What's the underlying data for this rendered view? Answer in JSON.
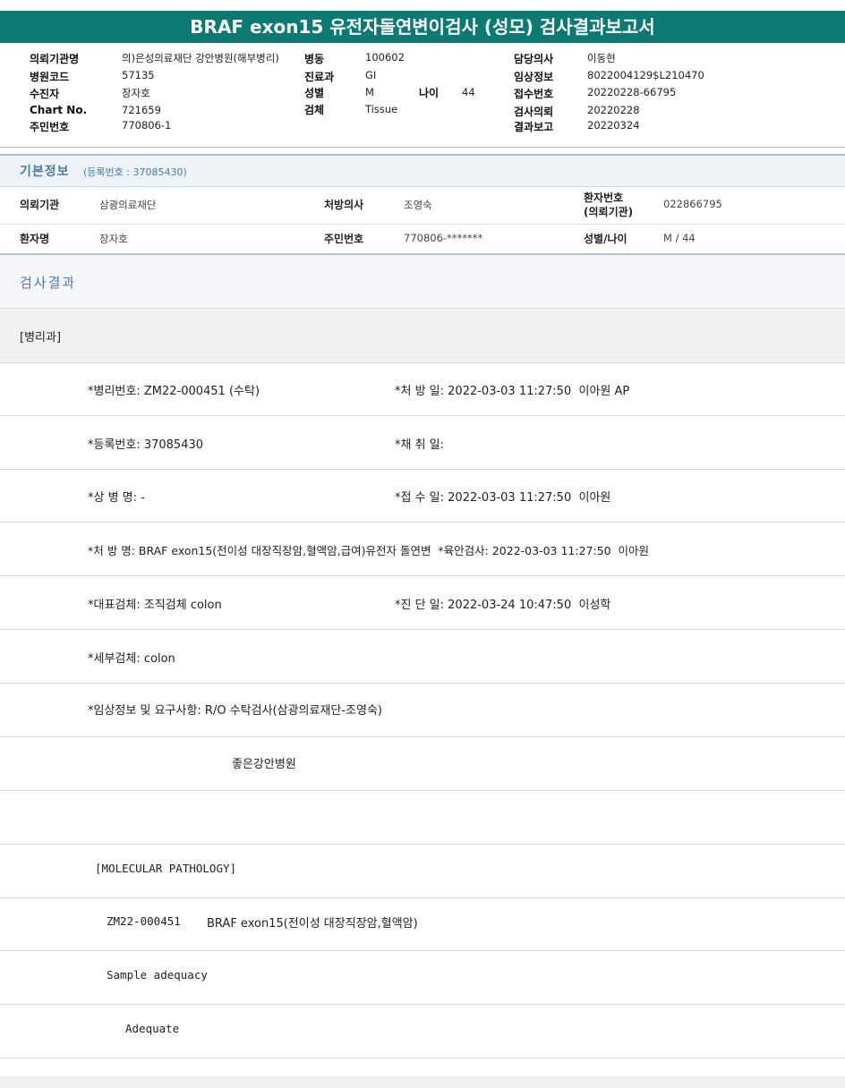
{
  "title": "BRAF exon15 유전자돌연변이검사 (성모) 검사결과보고서",
  "header": {
    "inst_label": "의뢰기관명",
    "inst_value": "의)은성의료재단 강안병원(해부병리)",
    "code_label": "병원코드",
    "code_value": "57135",
    "recv_label": "수진자",
    "recv_value": "장자호",
    "chart_label": "Chart No.",
    "chart_value": "721659",
    "rrn_label": "주민번호",
    "rrn_value": "770806-1",
    "ward_label": "병동",
    "ward_value": "100602",
    "dept_label": "진료과",
    "dept_value": "GI",
    "sex_label": "성별",
    "sex_value": "M",
    "age_label": "나이",
    "age_value": "44",
    "spec_label": "검체",
    "spec_value": "Tissue",
    "doctor_label": "담당의사",
    "doctor_value": "이동현",
    "clinic_label": "임상정보",
    "clinic_value": "8022004129$L210470",
    "receipt_label": "접수번호",
    "receipt_value": "20220228-66795",
    "req_label": "검사의뢰",
    "req_value": "20220228",
    "report_label": "결과보고",
    "report_value": "20220324"
  },
  "basic": {
    "title": "기본정보",
    "sub": "(등록번호 : 37085430)",
    "row1": {
      "inst_label": "의뢰기관",
      "inst_value": "삼광의료재단",
      "doc_label": "처방의사",
      "doc_value": "조영숙",
      "pno_label_1": "환자번호",
      "pno_label_2": "(의뢰기관)",
      "pno_value": "022866795"
    },
    "row2": {
      "name_label": "환자명",
      "name_value": "장자호",
      "rrn_label": "주민번호",
      "rrn_value": "770806-*******",
      "sexage_label": "성별/나이",
      "sexage_value": "M / 44"
    }
  },
  "results": {
    "title": "검사결과",
    "dept": "[병리과]",
    "lines": [
      {
        "left": "*병리번호: ZM22-000451 (수탁)",
        "right": "*처 방 일: 2022-03-03 11:27:50  이아원 AP"
      },
      {
        "left": "*등록번호: 37085430",
        "right": "*채 취 일:"
      },
      {
        "left": "*상 병 명: -",
        "right": "*접 수 일: 2022-03-03 11:27:50  이아원"
      },
      {
        "left": "*처 방 명: BRAF exon15(전이성 대장직장암,혈액암,급여)유전자 돌연변  *육안검사: 2022-03-03 11:27:50  이아원",
        "right": ""
      },
      {
        "left": "*대표검체: 조직검체 colon",
        "right": "*진 단 일: 2022-03-24 10:47:50  이성학"
      },
      {
        "left": "*세부검체: colon",
        "right": ""
      },
      {
        "left": "*임상정보 및 요구사항: R/O 수탁검사(삼광의료재단-조영숙)",
        "right": ""
      }
    ],
    "hospital": "좋은강안병원",
    "mol_title": "[MOLECULAR PATHOLOGY]",
    "mol_no": "ZM22-000451",
    "mol_test": "BRAF exon15(전이성 대장직장암,혈액암)",
    "adequacy_label": "Sample adequacy",
    "adequacy_value": "Adequate"
  }
}
